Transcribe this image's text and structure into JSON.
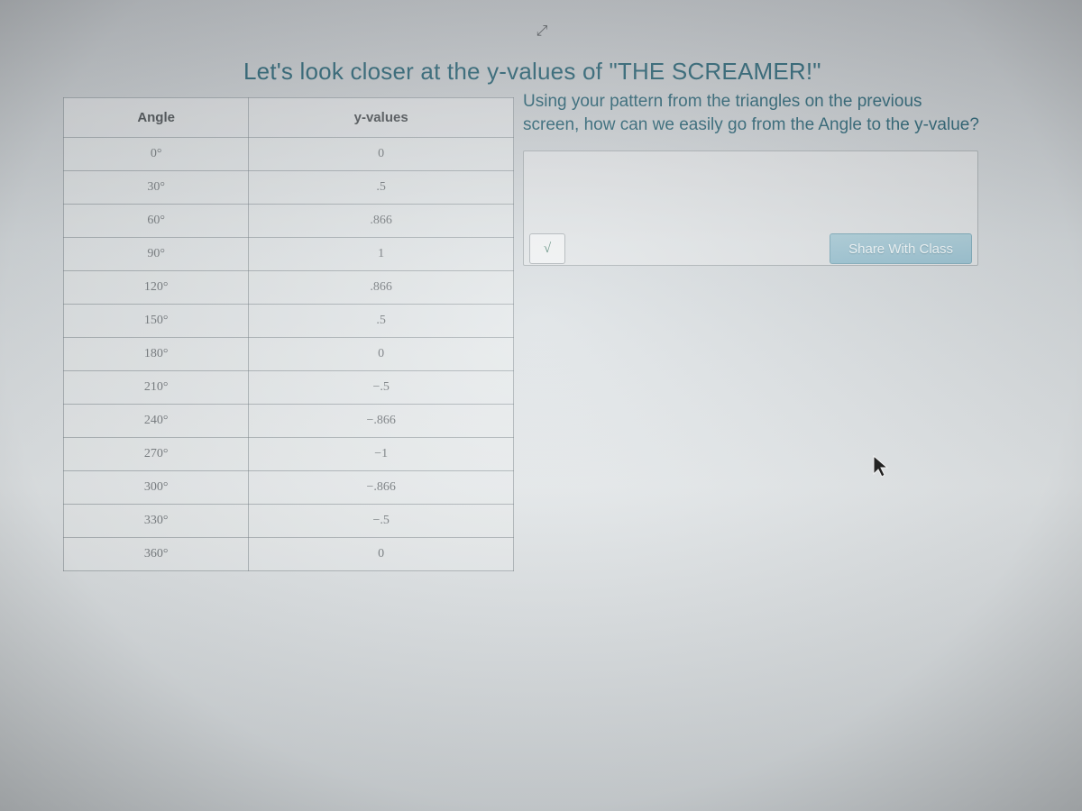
{
  "top_icon": "⤢",
  "title": "Let's look closer at the y-values of \"THE SCREAMER!\"",
  "table": {
    "headers": {
      "angle": "Angle",
      "yvalues": "y-values"
    },
    "rows": [
      {
        "angle": "0°",
        "y": "0"
      },
      {
        "angle": "30°",
        "y": ".5"
      },
      {
        "angle": "60°",
        "y": ".866"
      },
      {
        "angle": "90°",
        "y": "1"
      },
      {
        "angle": "120°",
        "y": ".866"
      },
      {
        "angle": "150°",
        "y": ".5"
      },
      {
        "angle": "180°",
        "y": "0"
      },
      {
        "angle": "210°",
        "y": "−.5"
      },
      {
        "angle": "240°",
        "y": "−.866"
      },
      {
        "angle": "270°",
        "y": "−1"
      },
      {
        "angle": "300°",
        "y": "−.866"
      },
      {
        "angle": "330°",
        "y": "−.5"
      },
      {
        "angle": "360°",
        "y": "0"
      }
    ]
  },
  "prompt": "Using your pattern from the triangles on the previous screen, how can we easily go from the Angle to the y-value?",
  "math_button": "√",
  "share_button": "Share With Class"
}
